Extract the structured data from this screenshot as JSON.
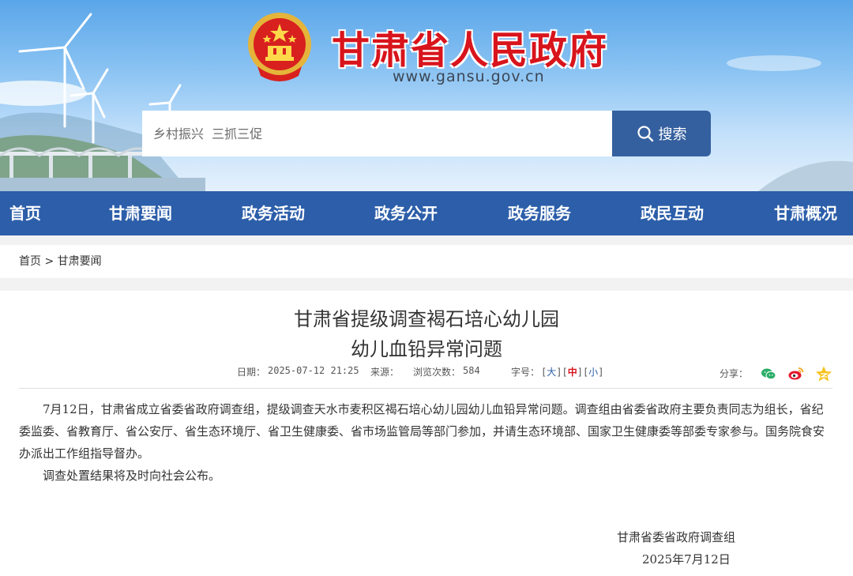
{
  "header": {
    "site_title": "甘肃省人民政府",
    "site_url": "www.gansu.gov.cn",
    "search_placeholder": "乡村振兴  三抓三促",
    "search_button": "搜索"
  },
  "nav": {
    "items": [
      "首页",
      "甘肃要闻",
      "政务活动",
      "政务公开",
      "政务服务",
      "政民互动",
      "甘肃概况"
    ]
  },
  "breadcrumb": {
    "home": "首页",
    "separator": ">",
    "current": "甘肃要闻"
  },
  "article": {
    "title_line1": "甘肃省提级调查褐石培心幼儿园",
    "title_line2": "幼儿血铅异常问题",
    "date_label": "日期：",
    "date": "2025-07-12 21:25",
    "source_label": "来源：",
    "views_label": "浏览次数：",
    "views": "584",
    "font_size_label": "字号：",
    "font_sizes": [
      "大",
      "中",
      "小"
    ],
    "share_label": "分享：",
    "paragraph1": "7月12日，甘肃省成立省委省政府调查组，提级调查天水市麦积区褐石培心幼儿园幼儿血铅异常问题。调查组由省委省政府主要负责同志为组长，省纪委监委、省教育厅、省公安厅、省生态环境厅、省卫生健康委、省市场监管局等部门参加，并请生态环境部、国家卫生健康委等部委专家参与。国务院食安办派出工作组指导督办。",
    "paragraph2": "调查处置结果将及时向社会公布。",
    "signature": "甘肃省委省政府调查组",
    "sign_date": "2025年7月12日"
  },
  "colors": {
    "title_red": "#d8141c",
    "nav_blue": "#2c5ea9",
    "search_button": "#35609f"
  }
}
